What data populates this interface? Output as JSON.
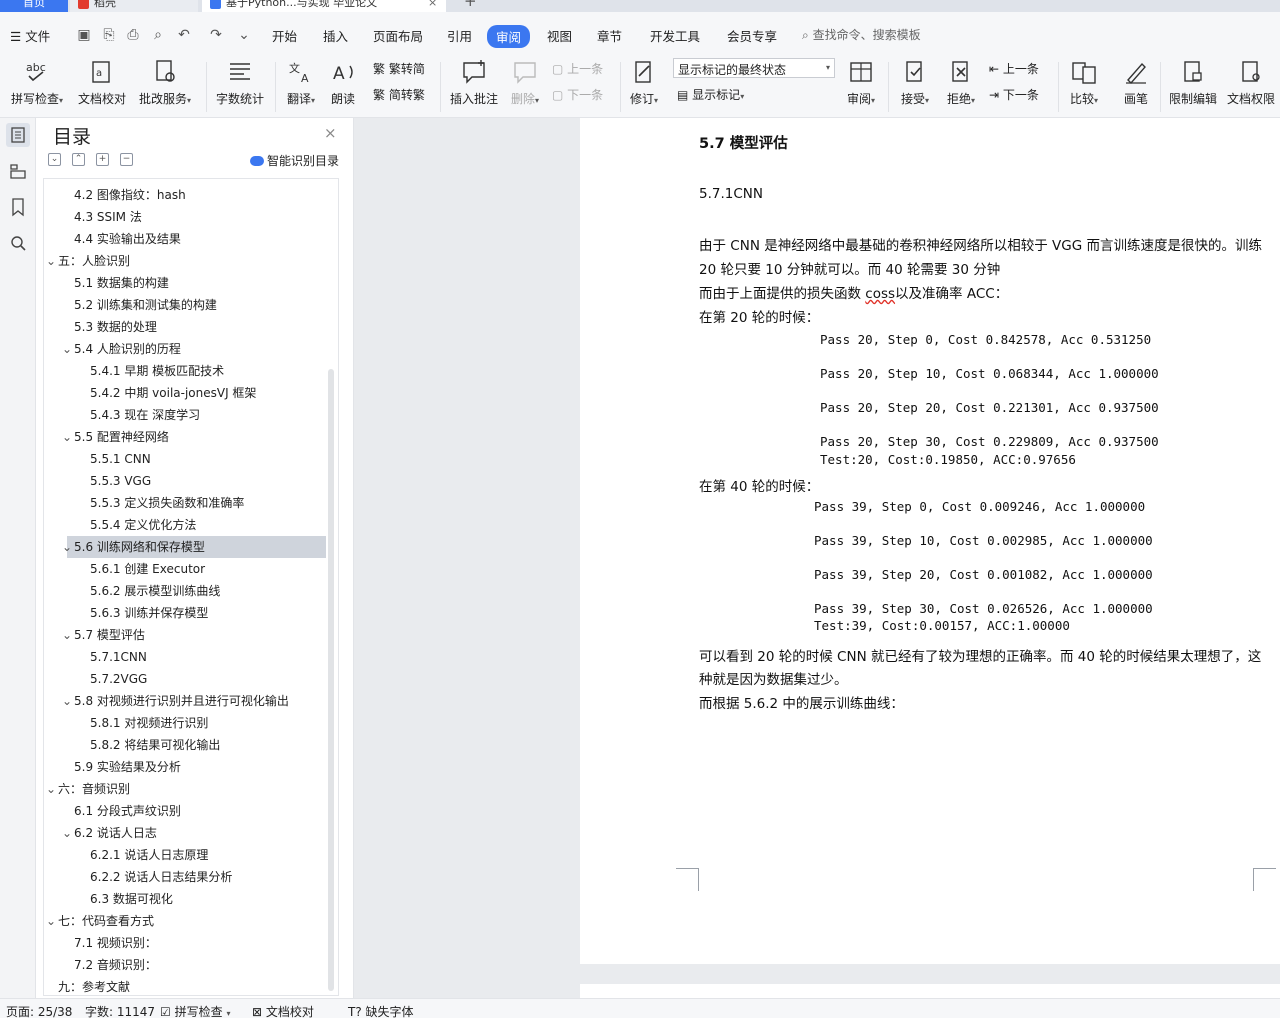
{
  "tabs": {
    "home": "首页",
    "dock": "稻壳",
    "doc": "基于Python...与实现 毕业论文",
    "plus": "+"
  },
  "menu": {
    "file": "文件",
    "items": [
      "开始",
      "插入",
      "页面布局",
      "引用",
      "审阅",
      "视图",
      "章节",
      "开发工具",
      "会员专享"
    ],
    "active": "审阅",
    "search": "查找命令、搜索模板"
  },
  "ribbon": {
    "spell": "拼写检查",
    "proof": "文档校对",
    "batch": "批改服务",
    "wordcount": "字数统计",
    "translate": "翻译",
    "read": "朗读",
    "trad": "繁转简",
    "simp": "简转繁",
    "insert_comment": "插入批注",
    "delete": "删除",
    "prev_comment": "上一条",
    "next_comment": "下一条",
    "track": "修订",
    "markup_state": "显示标记的最终状态",
    "show_markup": "显示标记",
    "review": "审阅",
    "accept": "接受",
    "reject": "拒绝",
    "prev_change": "上一条",
    "next_change": "下一条",
    "compare": "比较",
    "pen": "画笔",
    "restrict": "限制编辑",
    "permission": "文档权限"
  },
  "toc": {
    "title": "目录",
    "smart": "智能识别目录",
    "items": [
      {
        "level": 2,
        "text": "4.2  图像指纹：hash",
        "arrow": ""
      },
      {
        "level": 2,
        "text": "4.3 SSIM 法",
        "arrow": ""
      },
      {
        "level": 2,
        "text": "4.4  实验输出及结果",
        "arrow": ""
      },
      {
        "level": 1,
        "text": "五：人脸识别",
        "arrow": "v"
      },
      {
        "level": 2,
        "text": "5.1  数据集的构建",
        "arrow": ""
      },
      {
        "level": 2,
        "text": "5.2  训练集和测试集的构建",
        "arrow": ""
      },
      {
        "level": 2,
        "text": "5.3  数据的处理",
        "arrow": ""
      },
      {
        "level": 2,
        "text": "5.4  人脸识别的历程",
        "arrow": "v"
      },
      {
        "level": 3,
        "text": "5.4.1  早期  模板匹配技术",
        "arrow": ""
      },
      {
        "level": 3,
        "text": "5.4.2  中期  voila-jonesVJ 框架",
        "arrow": ""
      },
      {
        "level": 3,
        "text": "5.4.3  现在  深度学习",
        "arrow": ""
      },
      {
        "level": 2,
        "text": "5.5  配置神经网络",
        "arrow": "v"
      },
      {
        "level": 3,
        "text": "5.5.1 CNN",
        "arrow": ""
      },
      {
        "level": 3,
        "text": "5.5.3 VGG",
        "arrow": ""
      },
      {
        "level": 3,
        "text": "5.5.3  定义损失函数和准确率",
        "arrow": ""
      },
      {
        "level": 3,
        "text": "5.5.4  定义优化方法",
        "arrow": ""
      },
      {
        "level": 2,
        "text": "5.6  训练网络和保存模型",
        "arrow": "v",
        "selected": true
      },
      {
        "level": 3,
        "text": "5.6.1 创建 Executor",
        "arrow": ""
      },
      {
        "level": 3,
        "text": "5.6.2 展示模型训练曲线",
        "arrow": ""
      },
      {
        "level": 3,
        "text": "5.6.3 训练并保存模型",
        "arrow": ""
      },
      {
        "level": 2,
        "text": "5.7  模型评估",
        "arrow": "v"
      },
      {
        "level": 3,
        "text": "5.7.1CNN",
        "arrow": ""
      },
      {
        "level": 3,
        "text": "5.7.2VGG",
        "arrow": ""
      },
      {
        "level": 2,
        "text": "5.8  对视频进行识别并且进行可视化输出",
        "arrow": "v"
      },
      {
        "level": 3,
        "text": "5.8.1  对视频进行识别",
        "arrow": ""
      },
      {
        "level": 3,
        "text": "5.8.2  将结果可视化输出",
        "arrow": ""
      },
      {
        "level": 2,
        "text": "5.9  实验结果及分析",
        "arrow": ""
      },
      {
        "level": 1,
        "text": "六：音频识别",
        "arrow": "v"
      },
      {
        "level": 2,
        "text": "6.1  分段式声纹识别",
        "arrow": ""
      },
      {
        "level": 2,
        "text": "6.2  说话人日志",
        "arrow": "v"
      },
      {
        "level": 3,
        "text": "6.2.1  说话人日志原理",
        "arrow": ""
      },
      {
        "level": 3,
        "text": "6.2.2  说话人日志结果分析",
        "arrow": ""
      },
      {
        "level": 3,
        "text": "6.3  数据可视化",
        "arrow": ""
      },
      {
        "level": 1,
        "text": "七：代码查看方式",
        "arrow": "v"
      },
      {
        "level": 2,
        "text": "7.1  视频识别：",
        "arrow": ""
      },
      {
        "level": 2,
        "text": "7.2  音频识别：",
        "arrow": ""
      },
      {
        "level": 1,
        "text": "九：参考文献",
        "arrow": ""
      }
    ]
  },
  "document": {
    "heading": "5.7 模型评估",
    "subheading": "5.7.1CNN",
    "para1_line1": "由于 CNN 是神经网络中最基础的卷积神经网络所以相较于 VGG 而言训练速度是很快的。训练",
    "para1_line2": "20 轮只要 10 分钟就可以。而 40 轮需要 30 分钟",
    "para2_pre": "而由于上面提供的损失函数 ",
    "para2_word": "coss",
    "para2_post": "以及准确率 ACC：",
    "label20": "在第 20 轮的时候：",
    "log20": [
      "Pass 20, Step 0, Cost 0.842578, Acc 0.531250",
      "Pass 20, Step 10, Cost 0.068344, Acc 1.000000",
      "Pass 20, Step 20, Cost 0.221301, Acc 0.937500",
      "Pass 20, Step 30, Cost 0.229809, Acc 0.937500"
    ],
    "test20": "Test:20, Cost:0.19850, ACC:0.97656",
    "label40": "在第 40 轮的时候：",
    "log40": [
      "Pass 39, Step 0, Cost 0.009246, Acc 1.000000",
      "Pass 39, Step 10, Cost 0.002985, Acc 1.000000",
      "Pass 39, Step 20, Cost 0.001082, Acc 1.000000",
      "Pass 39, Step 30, Cost 0.026526, Acc 1.000000"
    ],
    "test40": "Test:39, Cost:0.00157, ACC:1.00000",
    "concl_line1": "可以看到 20 轮的时候 CNN 就已经有了较为理想的正确率。而 40 轮的时候结果太理想了，这",
    "concl_line2": "种就是因为数据集过少。",
    "concl_line3": "而根据 5.6.2 中的展示训练曲线："
  },
  "status": {
    "page": "页面: 25/38",
    "words": "字数: 11147",
    "spell": "拼写检查",
    "proof": "文档校对",
    "missing_font": "缺失字体"
  },
  "colors": {
    "accent": "#3b77f0",
    "selected_row": "#cfd4dc"
  }
}
